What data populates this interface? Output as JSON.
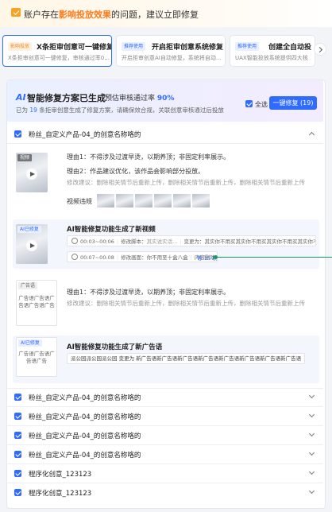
{
  "banner": {
    "text_before": "账户存在",
    "text_highlight": "影响投放效果",
    "text_after": "的问题，建议立即修复"
  },
  "cards": [
    {
      "tag": "影响投放",
      "title": "X条拒审创意可一键修复",
      "desc": "X条拒审创意可一键修复，审核通过率0..."
    },
    {
      "tag": "推荐使用",
      "title": "开启拒审创意系统修复",
      "desc": "开启拒审创意AI自动修复，系统将自动..."
    },
    {
      "tag": "推荐使用",
      "title": "创建全自动投",
      "desc": "UAX智能投放系统提供四大核"
    }
  ],
  "ai": {
    "title": "智能修复方案已生成",
    "rate_label": "预估审核通过率",
    "rate_value": "90%",
    "sub_prefix": "已为",
    "sub_count": "19",
    "sub_suffix": "条拒审创意生成了修复方案，请确保效合规，关联创意审核通过后投放",
    "select_all": "全选",
    "fix_button": "一键修复 (19)"
  },
  "section1": {
    "title": "粉丝_自定义产品-04_的创意名称咯的",
    "video_item": {
      "badge": "视频",
      "reason1": "理由1：不得涉及过渡早烫，以期养顶；非固定利率展示。",
      "reason2": "理由2：作品建议优化，该作品会影响部分投放。",
      "suggestion": "修改建议：删除相关情节后重新上传，删除相关情节后重新上传，删除相关情节后重新上传",
      "frames_label": "视频违规"
    },
    "ai_video": {
      "badge": "AI已修复",
      "heading": "AI智能修复功能生成了新视频",
      "row1_time": "00:03~00:06",
      "row1_label": "修改脚本：",
      "row1_text": "其实说实话...",
      "row1_after": "变更为：其实你不用买其实你不用买其实你不用买其实你不用买其实...",
      "row2_time": "00:07~00:08",
      "row2_label": "修改画面：",
      "row2_text": "你不用至十盒八盒",
      "row2_after": "内容删除",
      "more": "等 15 项"
    },
    "image_item": {
      "badge": "广告语",
      "thumb_text": "广告语广告语广告语广告语广告",
      "reason1": "理由1：不得涉及过渡早烫，以期养顶；非固定利率展示。",
      "suggestion": "修改建议：删除相关情节后重新上传，删除相关情节后重新上传，删除相关情节后重新上传"
    },
    "ai_copy": {
      "badge": "AI已修复",
      "thumb_text": "广告语广告语广告语广告",
      "heading": "AI智能修复功能生成了新广告语",
      "copy": "派公园派公园派公园 变更为 新广告语新广告语新广告语新广告语新广告语新广告语新广告语新广告语"
    }
  },
  "collapsed": [
    "粉丝_自定义产品-04_的创意名称咯的",
    "粉丝_自定义产品-04_的创意名称咯的",
    "粉丝_自定义产品-04_的创意名称咯的",
    "粉丝_自定义产品-04_的创意名称咯的",
    "程序化创意_123123",
    "程序化创意_123123"
  ]
}
